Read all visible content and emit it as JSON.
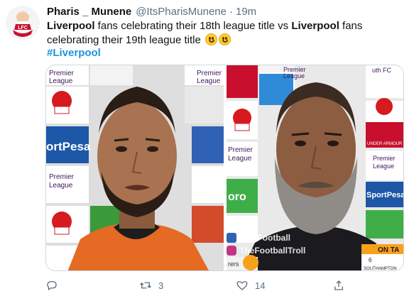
{
  "tweet": {
    "display_name": "Pharis _ Munene",
    "handle": "@ItsPharisMunene",
    "separator": "·",
    "time": "19m",
    "text_seg1": "Liverpool",
    "text_seg2": " fans celebrating their 18th league title vs ",
    "text_seg3": "Liverpool",
    "text_seg4": " fans celebrating their 19th league title ",
    "hashtag": "#Liverpool"
  },
  "avatar": {
    "text": "LFC"
  },
  "media": {
    "left_photo": {
      "board_text_1": "Premier",
      "board_text_2": "League",
      "board_text_3": "ortPesa",
      "board_text_4": "Premier",
      "board_text_5": "League",
      "board_text_6": "Premier",
      "board_text_7": "League"
    },
    "right_photo": {
      "board_text_1": "Premier",
      "board_text_2": "League",
      "board_text_3": "uth FC",
      "board_text_4": "Premier",
      "board_text_5": "League",
      "board_text_6": "UNDER ARMOUR",
      "board_text_7": "SportPesa",
      "board_text_8": "Premier",
      "board_text_9": "League",
      "board_text_10": "oro",
      "watermark_1": "TrollFootball",
      "watermark_2": "TheFootballTroll",
      "badge_text": "ON TA",
      "badge_number": "6",
      "badge_caption": "SOUTHAMPTON",
      "board_text_11": "rers"
    }
  },
  "actions": {
    "retweets": "3",
    "likes": "14"
  },
  "colors": {
    "link": "#1b95e0",
    "muted": "#5b7083",
    "liverpool_red": "#c8102e"
  }
}
